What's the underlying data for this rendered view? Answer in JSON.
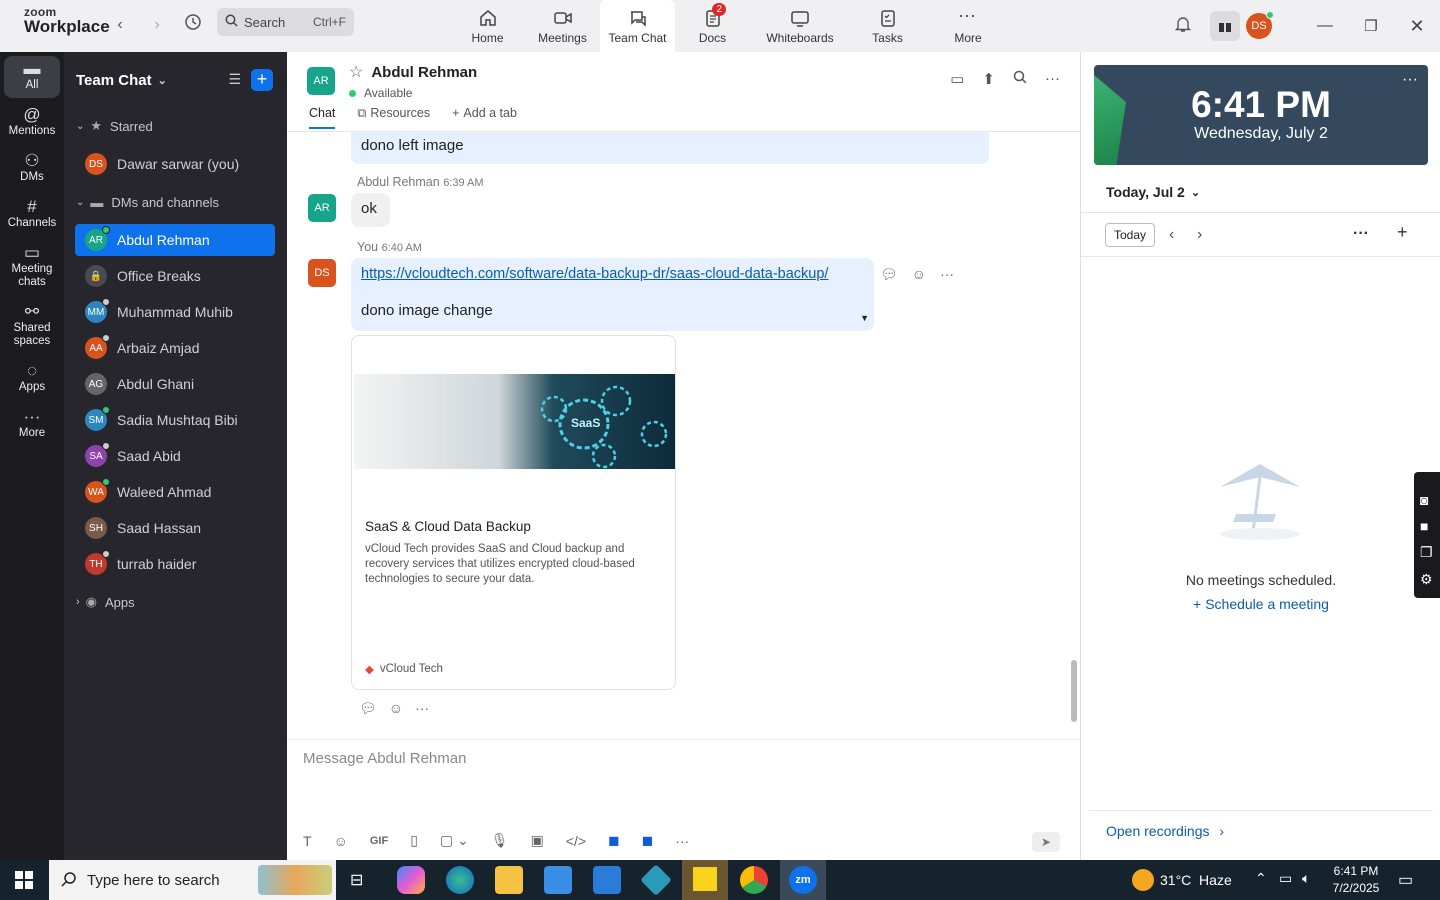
{
  "app": {
    "logo_top": "zoom",
    "logo_bottom": "Workplace"
  },
  "search": {
    "label": "Search",
    "shortcut": "Ctrl+F"
  },
  "topnav": [
    {
      "label": "Home",
      "icon": "home-icon"
    },
    {
      "label": "Meetings",
      "icon": "video-icon"
    },
    {
      "label": "Team Chat",
      "icon": "chat-icon"
    },
    {
      "label": "Docs",
      "icon": "docs-icon",
      "badge": "2"
    },
    {
      "label": "Whiteboards",
      "icon": "whiteboard-icon"
    },
    {
      "label": "Tasks",
      "icon": "tasks-icon"
    },
    {
      "label": "More",
      "icon": "more-icon"
    }
  ],
  "user": {
    "initials": "DS",
    "color": "#d9531e"
  },
  "rail": [
    {
      "label": "All",
      "icon": "chat-icon"
    },
    {
      "label": "Mentions",
      "icon": "at-icon"
    },
    {
      "label": "DMs",
      "icon": "people-icon"
    },
    {
      "label": "Channels",
      "icon": "hash-icon"
    },
    {
      "label": "Meeting chats",
      "icon": "meeting-chat-icon"
    },
    {
      "label": "Shared spaces",
      "icon": "shared-icon"
    },
    {
      "label": "Apps",
      "icon": "apps-icon"
    },
    {
      "label": "More",
      "icon": "more-icon"
    }
  ],
  "sidebar": {
    "title": "Team Chat",
    "starred_label": "Starred",
    "starred_item": {
      "name": "Dawar sarwar (you)",
      "initials": "DS",
      "color": "#d9531e"
    },
    "dms_label": "DMs and channels",
    "items": [
      {
        "name": "Abdul Rehman",
        "initials": "AR",
        "color": "#17a589",
        "status": "#2ecc71"
      },
      {
        "name": "Office Breaks",
        "initials": "🔒",
        "color": "#4a4a52",
        "status": ""
      },
      {
        "name": "Muhammad Muhib",
        "initials": "MM",
        "color": "#2e86c1",
        "status": "#ccc"
      },
      {
        "name": "Arbaiz Amjad",
        "initials": "AA",
        "color": "#d9531e",
        "status": "#ccc"
      },
      {
        "name": "Abdul Ghani",
        "initials": "AG",
        "color": "#666",
        "status": ""
      },
      {
        "name": "Sadia Mushtaq Bibi",
        "initials": "SM",
        "color": "#2e86c1",
        "status": "#2ecc71"
      },
      {
        "name": "Saad Abid",
        "initials": "SA",
        "color": "#8e44ad",
        "status": "#ccc"
      },
      {
        "name": "Waleed Ahmad",
        "initials": "WA",
        "color": "#d9531e",
        "status": "#2ecc71"
      },
      {
        "name": "Saad Hassan",
        "initials": "SH",
        "color": "#7a5c4a",
        "status": ""
      },
      {
        "name": "turrab haider",
        "initials": "TH",
        "color": "#c0392b",
        "status": "#ccc"
      }
    ],
    "apps_label": "Apps"
  },
  "chat": {
    "name": "Abdul Rehman",
    "initials": "AR",
    "status": "Available",
    "tabs": [
      "Chat",
      "Resources",
      "Add a tab"
    ],
    "messages": [
      {
        "text": "dono left image"
      },
      {
        "sender": "Abdul Rehman",
        "time": "6:39 AM",
        "text": "ok"
      },
      {
        "sender": "You",
        "time": "6:40 AM",
        "link": "https://vcloudtech.com/software/data-backup-dr/saas-cloud-data-backup/",
        "text": "dono image change"
      }
    ],
    "card": {
      "image_text": "SaaS",
      "title": "SaaS & Cloud Data Backup",
      "desc": "vCloud Tech provides SaaS and Cloud backup and recovery services that utilizes encrypted cloud-based technologies to secure your data.",
      "site": "vCloud Tech"
    },
    "compose_placeholder": "Message Abdul Rehman"
  },
  "calendar": {
    "time": "6:41 PM",
    "date": "Wednesday, July 2",
    "header": "Today, Jul 2",
    "today_btn": "Today",
    "empty": "No meetings scheduled.",
    "schedule": "Schedule a meeting",
    "recordings": "Open recordings"
  },
  "taskbar": {
    "search": "Type here to search",
    "weather": "31°C  Haze",
    "time": "6:41 PM",
    "date": "7/2/2025"
  }
}
